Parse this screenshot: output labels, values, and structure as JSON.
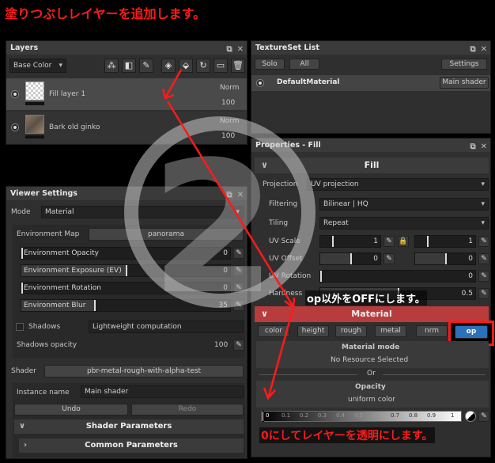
{
  "annotations": {
    "top": "塗りつぶしレイヤーを追加します。",
    "op_off": "op以外をOFFにします。",
    "zero": "0にしてレイヤーを透明にします。",
    "step": "2"
  },
  "layers": {
    "title": "Layers",
    "channel": "Base Color",
    "items": [
      {
        "name": "Fill layer 1",
        "blend": "Norm",
        "opacity": "100"
      },
      {
        "name": "Bark old ginko",
        "blend": "Norm",
        "opacity": "100"
      }
    ]
  },
  "textureset": {
    "title": "TextureSet List",
    "solo": "Solo",
    "all": "All",
    "settings": "Settings",
    "material": "DefaultMaterial",
    "shader": "Main shader"
  },
  "viewer": {
    "title": "Viewer Settings",
    "mode_label": "Mode",
    "mode_value": "Material",
    "env_map_label": "Environment Map",
    "env_map_value": "panorama",
    "sliders": [
      {
        "label": "Environment Opacity",
        "value": "0",
        "fill": 0
      },
      {
        "label": "Environment Exposure (EV)",
        "value": "0",
        "fill": 0.5
      },
      {
        "label": "Environment Rotation",
        "value": "0",
        "fill": 0
      },
      {
        "label": "Environment Blur",
        "value": "35",
        "fill": 0.35
      }
    ],
    "shadows_label": "Shadows",
    "shadows_value": "Lightweight computation",
    "shadows_opacity_label": "Shadows opacity",
    "shadows_opacity_value": "100",
    "shader_label": "Shader",
    "shader_value": "pbr-metal-rough-with-alpha-test",
    "instance_label": "Instance name",
    "instance_value": "Main shader",
    "undo": "Undo",
    "redo": "Redo",
    "shader_params": "Shader Parameters",
    "common_params": "Common Parameters"
  },
  "props": {
    "title": "Properties - Fill",
    "fill_section": "Fill",
    "projection_label": "Projection",
    "projection_value": "UV projection",
    "filtering_label": "Filtering",
    "filtering_value": "Bilinear | HQ",
    "tiling_label": "Tiling",
    "tiling_value": "Repeat",
    "uv_scale_label": "UV Scale",
    "uv_scale_a": "1",
    "uv_scale_b": "1",
    "uv_offset_label": "UV Offset",
    "uv_offset_a": "0",
    "uv_offset_b": "0",
    "uv_rotation_label": "UV Rotation",
    "uv_rotation_value": "0",
    "hardness_label": "Hardness",
    "hardness_value": "0.5",
    "material_section": "Material",
    "channels": [
      "color",
      "height",
      "rough",
      "metal",
      "nrm",
      "op"
    ],
    "material_mode_label": "Material mode",
    "material_mode_value": "No Resource Selected",
    "or_label": "Or",
    "opacity_label": "Opacity",
    "opacity_value": "uniform color",
    "ramp_ticks": [
      "0",
      "0.1",
      "0.2",
      "0.3",
      "0.4",
      "0.5",
      "0.6",
      "0.7",
      "0.8",
      "0.9",
      "1"
    ]
  }
}
